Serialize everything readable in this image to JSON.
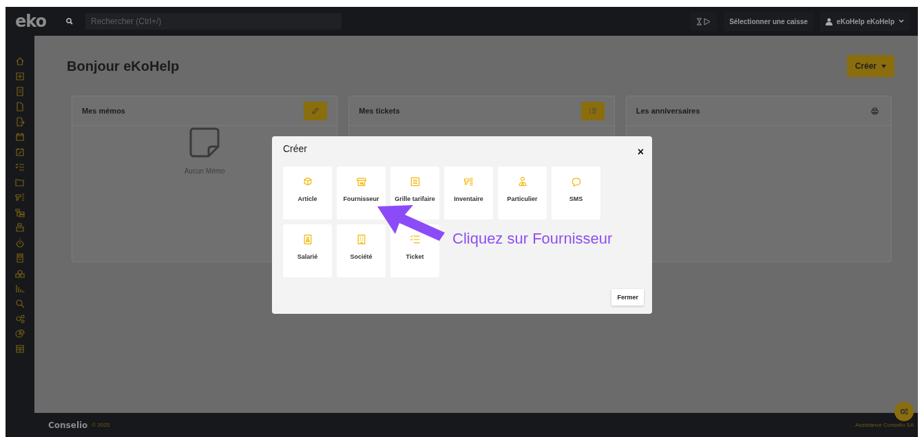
{
  "topbar": {
    "logo": "eko",
    "search_placeholder": "Rechercher (Ctrl+/)",
    "register": "Sélectionner une caisse",
    "user": "eKoHelp eKoHelp"
  },
  "page": {
    "greeting": "Bonjour eKoHelp",
    "create_button": "Créer"
  },
  "widgets": [
    {
      "title": "Mes mémos",
      "kind": "memos",
      "empty_text": "Aucun Mémo"
    },
    {
      "title": "Mes tickets",
      "kind": "tickets"
    },
    {
      "title": "Les anniversaires",
      "kind": "birthdays"
    }
  ],
  "dialog": {
    "title": "Créer",
    "close": "×",
    "items": [
      {
        "label": "Article",
        "kind": "box"
      },
      {
        "label": "Fournisseur",
        "kind": "store"
      },
      {
        "label": "Grille tarifaire",
        "kind": "list"
      },
      {
        "label": "Inventaire",
        "kind": "scanner"
      },
      {
        "label": "Particulier",
        "kind": "person"
      },
      {
        "label": "SMS",
        "kind": "sms"
      },
      {
        "label": "Salarié",
        "kind": "badge"
      },
      {
        "label": "Société",
        "kind": "building"
      },
      {
        "label": "Ticket",
        "kind": "checklist"
      }
    ],
    "button": "Fermer"
  },
  "annotation": {
    "text": "Cliquez sur Fournisseur"
  },
  "footer": {
    "brand": "Conselio",
    "copyright": "© 2025",
    "support": "Assistance Conselio SA"
  }
}
